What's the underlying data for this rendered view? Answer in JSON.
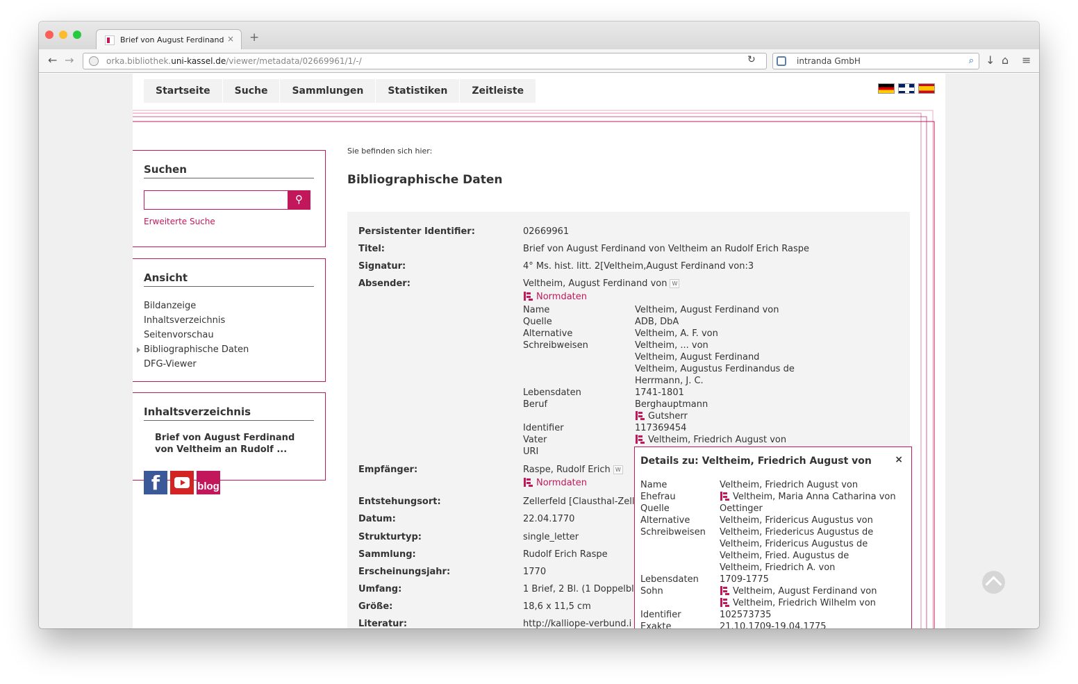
{
  "browser": {
    "tab_title": "Brief von August Ferdinand vo...",
    "tab_close": "×",
    "new_tab": "+",
    "url_prefix": "orka.bibliothek.",
    "url_domain": "uni-kassel.de",
    "url_path": "/viewer/metadata/02669961/1/-/",
    "search_engine_text": "intranda GmbH"
  },
  "nav": {
    "items": [
      "Startseite",
      "Suche",
      "Sammlungen",
      "Statistiken",
      "Zeitleiste"
    ]
  },
  "sidebar": {
    "search": {
      "heading": "Suchen",
      "advanced": "Erweiterte Suche",
      "placeholder": ""
    },
    "view": {
      "heading": "Ansicht",
      "items": [
        "Bildanzeige",
        "Inhaltsverzeichnis",
        "Seitenvorschau",
        "Bibliographische Daten",
        "DFG-Viewer"
      ]
    },
    "toc": {
      "heading": "Inhaltsverzeichnis",
      "entry": "Brief von August Ferdinand von Veltheim an Rudolf ..."
    },
    "social": {
      "facebook": "f",
      "blog": "blog"
    }
  },
  "main": {
    "breadcrumb": "Sie befinden sich hier:",
    "heading": "Bibliographische Daten",
    "normdaten": "Normdaten",
    "wiki_badge": "W",
    "fields": [
      {
        "label": "Persistenter Identifier:",
        "value": "02669961"
      },
      {
        "label": "Titel:",
        "value": "Brief von August Ferdinand von Veltheim an Rudolf Erich Raspe"
      },
      {
        "label": "Signatur:",
        "value": "4° Ms. hist. litt. 2[Veltheim,August Ferdinand von:3"
      },
      {
        "label": "Absender:",
        "value": "Veltheim, August Ferdinand von"
      },
      {
        "label": "Empfänger:",
        "value": "Raspe, Rudolf Erich"
      },
      {
        "label": "Entstehungsort:",
        "value": "Zellerfeld [Clausthal-Zell"
      },
      {
        "label": "Datum:",
        "value": "22.04.1770"
      },
      {
        "label": "Strukturtyp:",
        "value": "single_letter"
      },
      {
        "label": "Sammlung:",
        "value": "Rudolf Erich Raspe"
      },
      {
        "label": "Erscheinungsjahr:",
        "value": "1770"
      },
      {
        "label": "Umfang:",
        "value": "1 Brief, 2 Bl. (1 Doppelbl"
      },
      {
        "label": "Größe:",
        "value": "18,6 x 11,5 cm"
      },
      {
        "label": "Literatur:",
        "value": "http://kalliope-verbund.i"
      }
    ],
    "absender_details": {
      "labels": {
        "name": "Name",
        "quelle": "Quelle",
        "alt1": "Alternative",
        "alt2": "Schreibweisen",
        "lebensdaten": "Lebensdaten",
        "beruf": "Beruf",
        "identifier": "Identifier",
        "vater": "Vater",
        "uri": "URI"
      },
      "name": "Veltheim, August Ferdinand von",
      "quelle": "ADB, DbA",
      "alternatives": [
        "Veltheim, A. F. von",
        "Veltheim, ... von",
        "Veltheim, August Ferdinand",
        "Veltheim, Augustus Ferdinandus de",
        "Herrmann, J. C."
      ],
      "lebensdaten": "1741-1801",
      "beruf": [
        "Berghauptmann",
        "Gutsherr"
      ],
      "identifier": "117369454",
      "vater": "Veltheim, Friedrich August von"
    }
  },
  "popup": {
    "title": "Details zu: Veltheim, Friedrich August von",
    "close": "×",
    "labels": {
      "name": "Name",
      "ehefrau": "Ehefrau",
      "quelle": "Quelle",
      "alt1": "Alternative",
      "alt2": "Schreibweisen",
      "lebensdaten": "Lebensdaten",
      "sohn": "Sohn",
      "identifier": "Identifier",
      "exakte": "Exakte"
    },
    "name": "Veltheim, Friedrich August von",
    "ehefrau_1": "Veltheim, Maria Anna Catharina von",
    "ehefrau_2": "Oettinger",
    "alternatives": [
      "Veltheim, Fridericus Augustus von",
      "Veltheim, Friedericus Augustus de",
      "Veltheim, Fridericus Augustus de",
      "Veltheim, Fried. Augustus de",
      "Veltheim, Friedrich A. von"
    ],
    "lebensdaten": "1709-1775",
    "sohn": [
      "Veltheim, August Ferdinand von",
      "Veltheim, Friedrich Wilhelm von"
    ],
    "identifier": "102573735",
    "exakte": "21.10.1709-19.04.1775"
  },
  "colors": {
    "accent": "#c2185b"
  }
}
